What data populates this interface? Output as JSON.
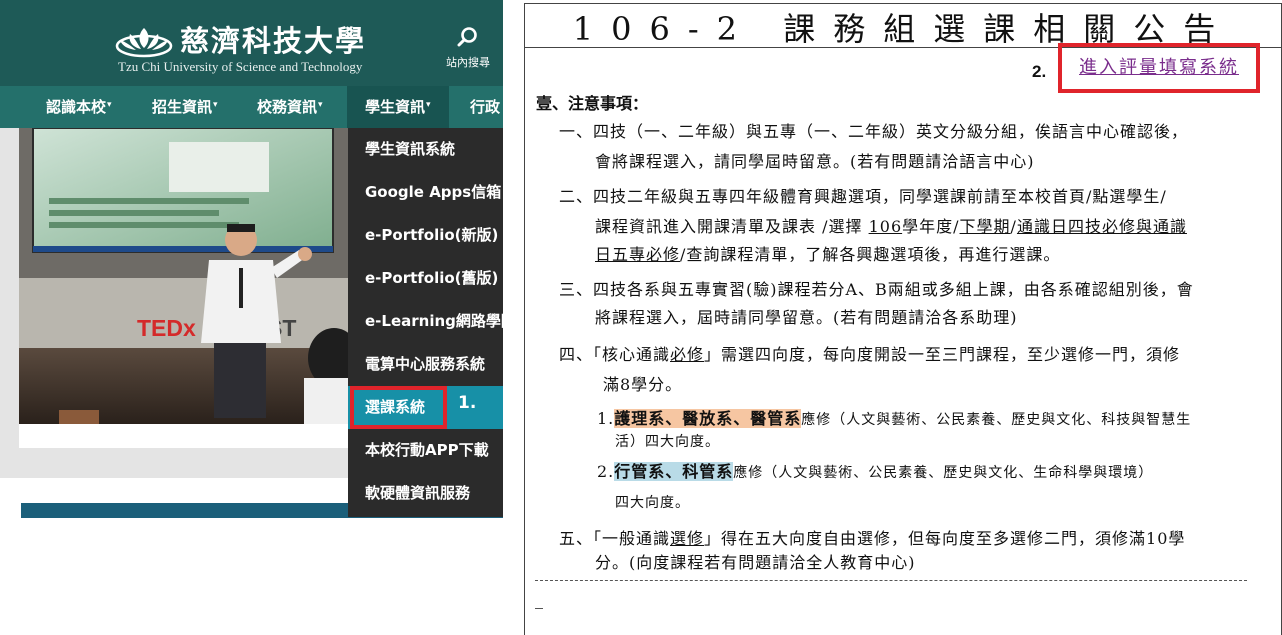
{
  "site": {
    "title": "慈濟科技大學",
    "subtitle": "Tzu Chi University of Science and Technology",
    "search_label": "站內搜尋",
    "nav": [
      {
        "label": "認識本校"
      },
      {
        "label": "招生資訊"
      },
      {
        "label": "校務資訊"
      },
      {
        "label": "學生資訊"
      },
      {
        "label": "行政"
      }
    ],
    "dropdown": [
      {
        "label": "學生資訊系統"
      },
      {
        "label": "Google Apps信箱"
      },
      {
        "label": "e-Portfolio(新版)"
      },
      {
        "label": "e-Portfolio(舊版)"
      },
      {
        "label": "e-Learning網路學園"
      },
      {
        "label": "電算中心服務系統"
      },
      {
        "label": "選課系統"
      },
      {
        "label": "本校行動APP下載"
      },
      {
        "label": "軟硬體資訊服務"
      }
    ],
    "photo_caption": "TEDx",
    "step_marker": "1."
  },
  "doc": {
    "title": "106-2 課務組選課相關公告",
    "step_marker": "2.",
    "eval_link": "進入評量填寫系統",
    "notice_heading": "壹、注意事項：",
    "item1_line1": "一、四技（一、二年級）與五專（一、二年級）英文分級分組，俟語言中心確認後，",
    "item1_line2": "會將課程選入，請同學屆時留意。(若有問題請洽語言中心)",
    "item2_line1": "二、四技二年級與五專四年級體育興趣選項，同學選課前請至本校首頁/點選學生/",
    "item2_line2_a": "課程資訊進入開課清單及課表 /選擇 ",
    "item2_line2_b": "106",
    "item2_line2_c": "學年度/",
    "item2_line2_d": "下學期",
    "item2_line2_e": "/",
    "item2_line2_f": "通識日四技必修與通識",
    "item2_line3_a": "日五專必修",
    "item2_line3_b": "/查詢課程清單，了解各興趣選項後，再進行選課。",
    "item3_line1": "三、四技各系與五專實習(驗)課程若分A、B兩組或多組上課，由各系確認組別後，會",
    "item3_line2": "將課程選入，屆時請同學留意。(若有問題請洽各系助理)",
    "item4_line1_a": "四、「核心通識",
    "item4_line1_b": "必修",
    "item4_line1_c": "」需選四向度，每向度開設一至三門課程，至少選修一門，須修",
    "item4_line2": "滿8學分。",
    "sub1_num": "1.",
    "sub1_depts": "護理系、醫放系、醫管系",
    "sub1_text": "應修（人文與藝術、公民素養、歷史與文化、科技與智慧生",
    "sub1_line2": "活）四大向度。",
    "sub2_num": "2.",
    "sub2_depts": "行管系、科管系",
    "sub2_text": "應修（人文與藝術、公民素養、歷史與文化、生命科學與環境）",
    "sub2_line2": "四大向度。",
    "item5_line1_a": "五、「一般通識",
    "item5_line1_b": "選修",
    "item5_line1_c": "」得在五大向度自由選修，但每向度至多選修二門，須修滿10學",
    "item5_line2": "分。(向度課程若有問題請洽全人教育中心)"
  }
}
